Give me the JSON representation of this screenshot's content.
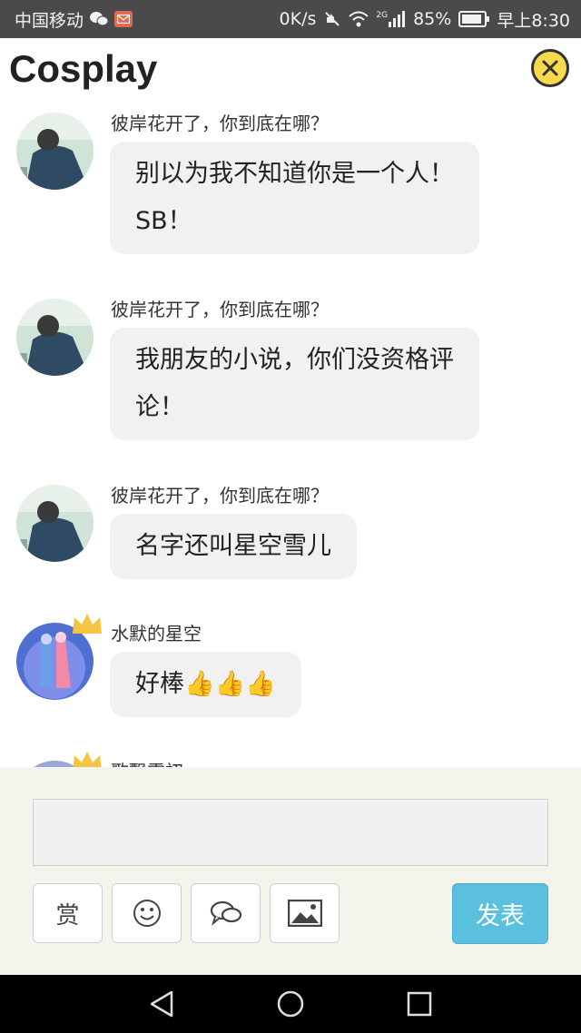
{
  "status_bar": {
    "carrier": "中国移动",
    "speed": "0K/s",
    "network": "2G",
    "battery": "85%",
    "time": "早上8:30"
  },
  "header": {
    "title": "Cosplay"
  },
  "messages": [
    {
      "user": "彼岸花开了，你到底在哪？",
      "lines": [
        "别以为我不知道你是一个人！",
        "SB！"
      ],
      "avatar": "user-photo"
    },
    {
      "user": "彼岸花开了，你到底在哪？",
      "lines": [
        "我朋友的小说，你们没资格评",
        "论！"
      ],
      "avatar": "user-photo"
    },
    {
      "user": "彼岸花开了，你到底在哪？",
      "lines": [
        "名字还叫星空雪儿"
      ],
      "avatar": "user-photo"
    },
    {
      "user": "水默的星空",
      "lines": [
        "好棒👍👍👍"
      ],
      "avatar": "anime-avatar",
      "badge": "crown"
    },
    {
      "user": "歌飘雪初",
      "lines": [],
      "avatar": "anime-avatar",
      "badge": "crown"
    }
  ],
  "compose": {
    "input_value": "",
    "input_placeholder": "",
    "reward_label": "赏",
    "send_label": "发表"
  },
  "icons": {
    "close": "close-icon",
    "emoji": "smiley-icon",
    "comments": "chat-bubbles-icon",
    "image": "image-icon",
    "back": "back-icon",
    "home": "home-icon",
    "recents": "recents-icon"
  },
  "colors": {
    "close_button": "#f7d94c",
    "send_button": "#5bc0de",
    "compose_background": "#f4f3ec",
    "bubble": "#f1f1f1",
    "status_bar": "#4a4a4a"
  }
}
